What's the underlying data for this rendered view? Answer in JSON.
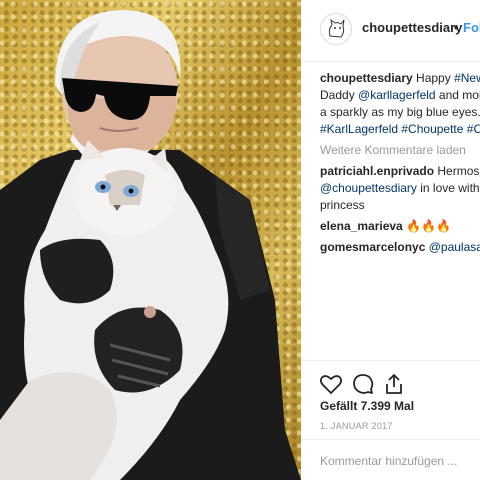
{
  "header": {
    "username": "choupettesdiary",
    "separator": "•",
    "follow_label": "Folg"
  },
  "caption": {
    "username": "choupettesdiary",
    "text_1": " Happy ",
    "hashtag_newyear": "#NewY",
    "text_2": "Daddy ",
    "mention_karl": "@karllagerfeld",
    "text_3": " and moi.",
    "text_4": "a sparkly as my big blue eyes.",
    "hashtags": "#KarlLagerfeld #Choupette #Ch"
  },
  "load_more": "Weitere Kommentare laden",
  "comments": [
    {
      "username": "patriciahl.enprivado",
      "text": " Hermosa",
      "mention": "@choupettesdiary",
      "text_2": " in love with t",
      "text_3": "princess"
    },
    {
      "username": "elena_marieva",
      "text": " 🔥🔥🔥"
    },
    {
      "username": "gomesmarcelonyc",
      "mention": " @paulasant"
    }
  ],
  "actions": {
    "like_icon": "heart-icon",
    "comment_icon": "comment-icon",
    "share_icon": "share-icon",
    "likes": "Gefällt 7.399 Mal",
    "date": "1. JANUAR 2017",
    "add_comment_placeholder": "Kommentar hinzufügen ..."
  }
}
